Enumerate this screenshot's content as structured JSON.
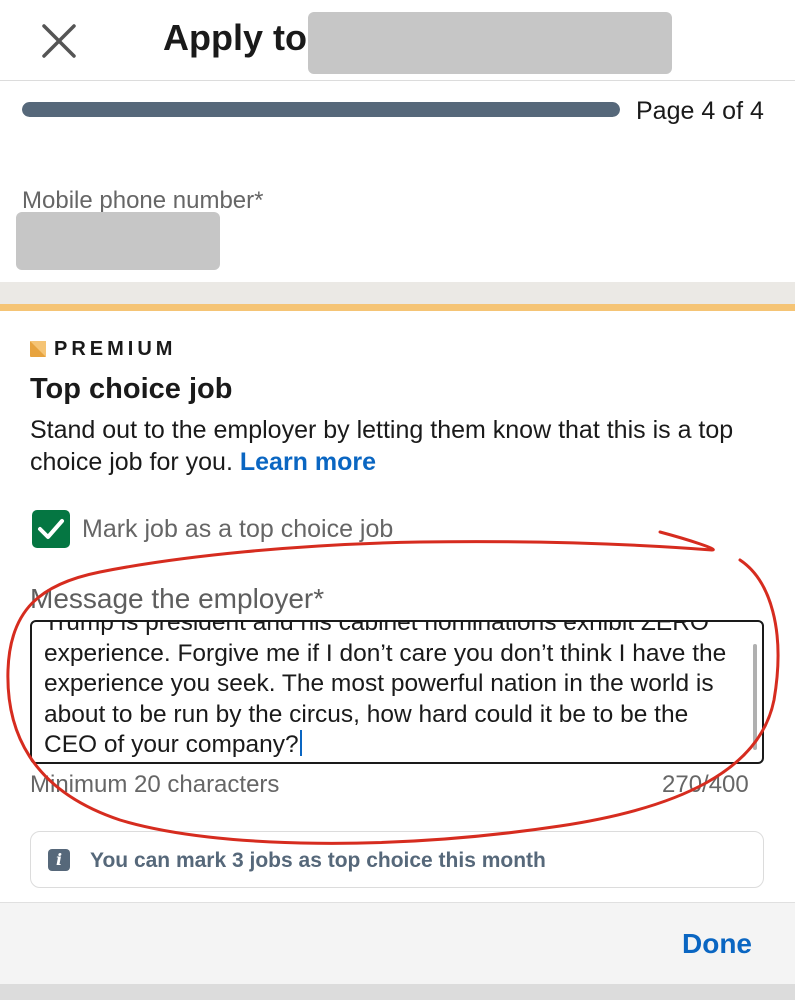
{
  "header": {
    "title": "Apply to",
    "close_icon": "close-icon"
  },
  "progress": {
    "fraction": 1.0,
    "page_label": "Page 4 of 4"
  },
  "phone": {
    "label": "Mobile phone number*"
  },
  "premium": {
    "badge_label": "PREMIUM",
    "title": "Top choice job",
    "description": "Stand out to the employer by letting them know that this is a top choice job for you.",
    "learn_more": "Learn more",
    "checkbox_label": "Mark job as a top choice job",
    "checkbox_checked": true
  },
  "message": {
    "label": "Message the employer*",
    "value": "Trump is president and his cabinet nominations exhibit ZERO experience. Forgive me if I don’t care you don’t think I have the experience you seek. The most powerful nation in the world is about to be run by the circus, how hard could it be to be the CEO of your company?",
    "hint": "Minimum 20 characters",
    "char_count": "270/400"
  },
  "info": {
    "text": "You can mark 3 jobs as top choice this month"
  },
  "footer": {
    "done_label": "Done"
  },
  "colors": {
    "accent": "#0a66c2",
    "checkbox_green": "#057642",
    "premium_gold": "#f5c475",
    "progress_fill": "#56687a",
    "annotation_red": "#d62c1f"
  }
}
